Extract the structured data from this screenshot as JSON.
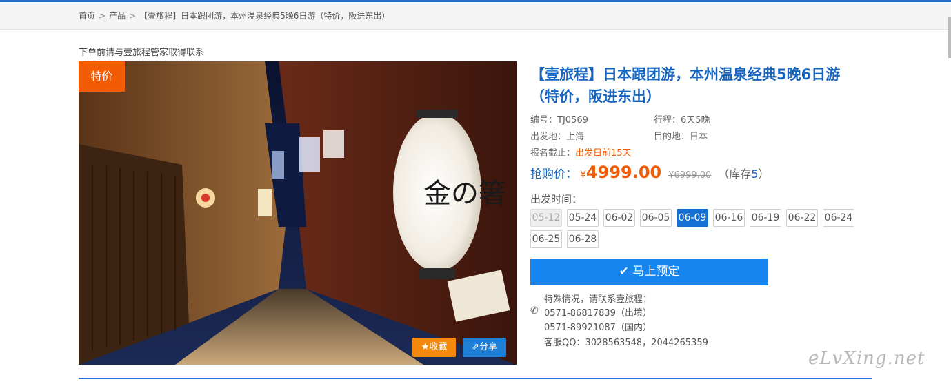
{
  "breadcrumb": {
    "home": "首页",
    "products": "产品",
    "current": "【壹旅程】日本跟团游，本州温泉经典5晚6日游（特价，阪进东出）"
  },
  "note": "下单前请与壹旅程管家取得联系",
  "photo": {
    "badge": "特价",
    "fav_label": "收藏",
    "share_label": "分享",
    "lantern_text": "金の箸"
  },
  "product": {
    "title_line1": "【壹旅程】日本跟团游，本州温泉经典5晚6日游",
    "title_line2": "（特价，阪进东出）",
    "code_label": "编号：",
    "code": "TJ0569",
    "trip_label": "行程：",
    "trip": "6天5晚",
    "from_label": "出发地：",
    "from": "上海",
    "dest_label": "目的地：",
    "dest": "日本",
    "deadline_label": "报名截止：",
    "deadline": "出发日前15天"
  },
  "price": {
    "label": "抢购价：",
    "yen": "¥",
    "value": "4999.00",
    "old": "¥6999.00",
    "stock_open": "（库存",
    "stock": "5",
    "stock_close": "）"
  },
  "departure": {
    "label": "出发时间：",
    "dates": [
      {
        "text": "05-12",
        "state": "disabled"
      },
      {
        "text": "05-24",
        "state": "normal"
      },
      {
        "text": "06-02",
        "state": "normal"
      },
      {
        "text": "06-05",
        "state": "normal"
      },
      {
        "text": "06-09",
        "state": "active"
      },
      {
        "text": "06-16",
        "state": "normal"
      },
      {
        "text": "06-19",
        "state": "normal"
      },
      {
        "text": "06-22",
        "state": "normal"
      },
      {
        "text": "06-24",
        "state": "normal"
      },
      {
        "text": "06-25",
        "state": "normal"
      },
      {
        "text": "06-28",
        "state": "normal"
      }
    ]
  },
  "book_button": "马上预定",
  "contact": {
    "intro": "特殊情况，请联系壹旅程：",
    "phone1": "0571-86817839（出境）",
    "phone2": "0571-89921087（国内）",
    "qq": "客服QQ：3028563548，2044265359"
  },
  "watermark": "eLvXing.net",
  "colors": {
    "accent": "#1665c0",
    "price": "#f25c05",
    "book": "#1785f0",
    "badge": "#f25c05",
    "fav": "#f38a0c",
    "share": "#1f7fd5"
  }
}
